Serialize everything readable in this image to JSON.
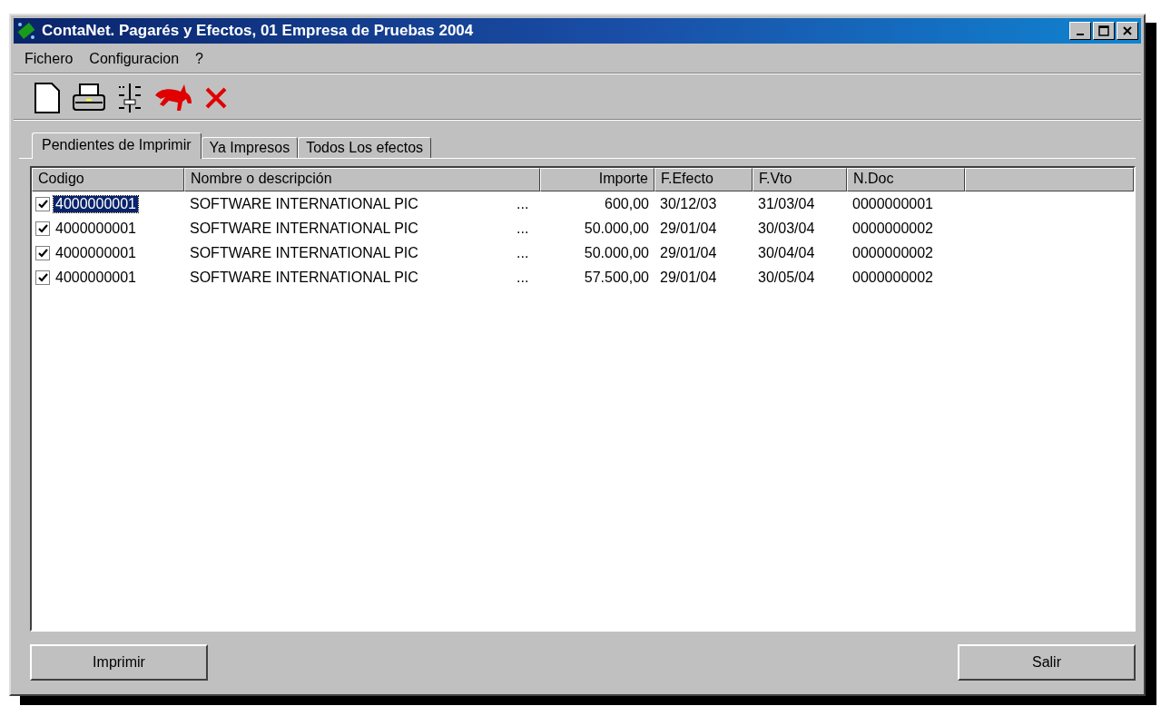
{
  "window": {
    "title": "ContaNet. Pagarés y Efectos, 01 Empresa de Pruebas 2004"
  },
  "menu": [
    "Fichero",
    "Configuracion",
    "?"
  ],
  "toolbar": [
    {
      "kind": "new"
    },
    {
      "kind": "print"
    },
    {
      "kind": "slider"
    },
    {
      "kind": "animal"
    },
    {
      "kind": "delete"
    }
  ],
  "tabs": [
    {
      "label": "Pendientes de Imprimir",
      "selected": true
    },
    {
      "label": "Ya Impresos",
      "selected": false
    },
    {
      "label": "Todos Los efectos",
      "selected": false
    }
  ],
  "table": {
    "columns": [
      "Codigo",
      "Nombre o descripción",
      "Importe",
      "F.Efecto",
      "F.Vto",
      "N.Doc"
    ],
    "rows": [
      {
        "checked": true,
        "selected": true,
        "codigo": "4000000001",
        "nombre": "SOFTWARE INTERNATIONAL PIC",
        "more": "...",
        "importe": "600,00",
        "f_efecto": "30/12/03",
        "f_vto": "31/03/04",
        "n_doc": "0000000001"
      },
      {
        "checked": true,
        "selected": false,
        "codigo": "4000000001",
        "nombre": "SOFTWARE INTERNATIONAL PIC",
        "more": "...",
        "importe": "50.000,00",
        "f_efecto": "29/01/04",
        "f_vto": "30/03/04",
        "n_doc": "0000000002"
      },
      {
        "checked": true,
        "selected": false,
        "codigo": "4000000001",
        "nombre": "SOFTWARE INTERNATIONAL PIC",
        "more": "...",
        "importe": "50.000,00",
        "f_efecto": "29/01/04",
        "f_vto": "30/04/04",
        "n_doc": "0000000002"
      },
      {
        "checked": true,
        "selected": false,
        "codigo": "4000000001",
        "nombre": "SOFTWARE INTERNATIONAL PIC",
        "more": "...",
        "importe": "57.500,00",
        "f_efecto": "29/01/04",
        "f_vto": "30/05/04",
        "n_doc": "0000000002"
      }
    ]
  },
  "buttons": [
    "Imprimir",
    "Salir"
  ]
}
